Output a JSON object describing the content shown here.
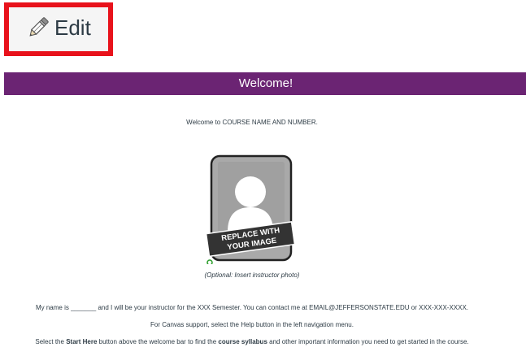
{
  "edit": {
    "label": "Edit",
    "icon": "pencil-icon",
    "highlight_color": "#e8121b"
  },
  "banner": {
    "title": "Welcome!",
    "color": "#6b2473"
  },
  "content": {
    "welcome_prefix": "Welcome to ",
    "course_placeholder": "COURSE NAME AND NUMBER.",
    "photo": {
      "badge_line1": "REPLACE WITH",
      "badge_line2": "YOUR IMAGE"
    },
    "photo_caption": "(Optional: Insert instructor photo)",
    "instructor_line": "My name is _______ and I will be your instructor for the XXX Semester. You can contact me at EMAIL@JEFFERSONSTATE.EDU or XXX-XXX-XXXX.",
    "support_line": "For Canvas support, select the Help button in the left navigation menu.",
    "start_line": {
      "part1": "Select the ",
      "bold1": "Start Here",
      "part2": " button above the welcome bar to find the ",
      "bold2": "course syllabus",
      "part3": " and other important information you need to get started in the course."
    }
  }
}
